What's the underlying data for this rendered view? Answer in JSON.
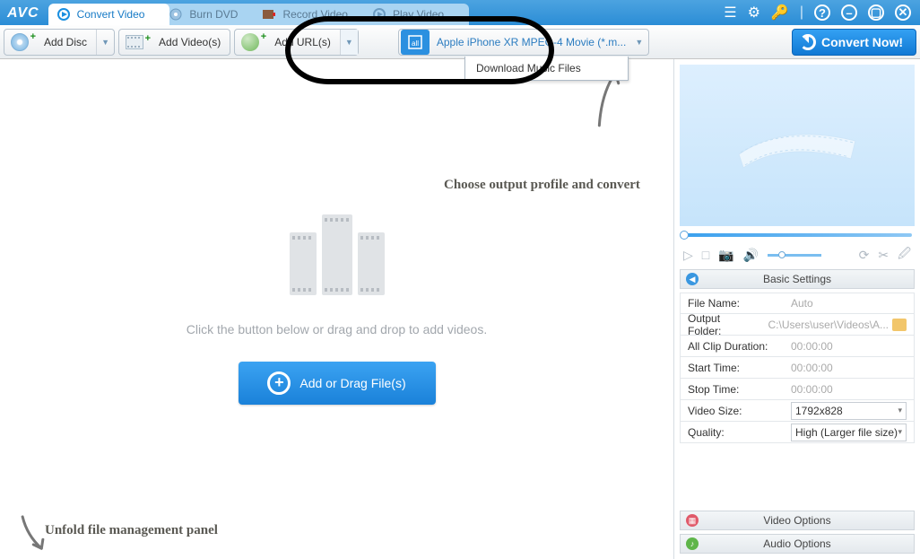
{
  "app": {
    "logo": "AVC"
  },
  "tabs": [
    {
      "label": "Convert Video",
      "active": true
    },
    {
      "label": "Burn DVD",
      "active": false
    },
    {
      "label": "Record Video",
      "active": false
    },
    {
      "label": "Play Video",
      "active": false
    }
  ],
  "toolbar": {
    "addDisc": "Add Disc",
    "addVideos": "Add Video(s)",
    "addUrls": "Add URL(s)",
    "profile": "Apple iPhone XR MPEG-4 Movie (*.m...",
    "convert": "Convert Now!"
  },
  "dropdown": {
    "item1": "Download Music Files"
  },
  "main": {
    "hint": "Click the button below or drag and drop to add videos.",
    "addBtn": "Add or Drag File(s)"
  },
  "settings": {
    "header": "Basic Settings",
    "rows": {
      "fileName": {
        "label": "File Name:",
        "value": "Auto"
      },
      "outputFolder": {
        "label": "Output Folder:",
        "value": "C:\\Users\\user\\Videos\\A..."
      },
      "clipDuration": {
        "label": "All Clip Duration:",
        "value": "00:00:00"
      },
      "startTime": {
        "label": "Start Time:",
        "value": "00:00:00"
      },
      "stopTime": {
        "label": "Stop Time:",
        "value": "00:00:00"
      },
      "videoSize": {
        "label": "Video Size:",
        "value": "1792x828"
      },
      "quality": {
        "label": "Quality:",
        "value": "High (Larger file size)"
      }
    },
    "videoOptions": "Video Options",
    "audioOptions": "Audio Options"
  },
  "annotations": {
    "chooseProfile": "Choose output profile and convert",
    "unfoldPanel": "Unfold file management panel"
  }
}
